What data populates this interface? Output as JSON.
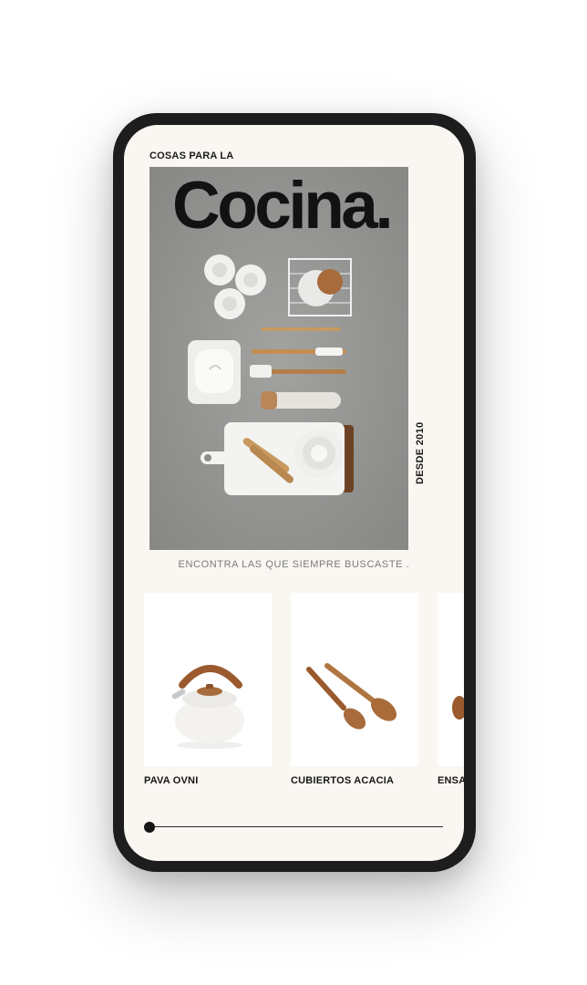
{
  "header": {
    "kicker": "COSAS PARA LA",
    "title": "Cocina.",
    "side_text": "DESDE 2010"
  },
  "tagline": "ENCONTRA LAS QUE SIEMPRE BUSCASTE .",
  "products": [
    {
      "name": "PAVA OVNI",
      "icon": "kettle-image"
    },
    {
      "name": "CUBIERTOS ACACIA",
      "icon": "wooden-spoons-image"
    },
    {
      "name": "ENSA",
      "icon": "salad-bowl-image"
    }
  ],
  "slider": {
    "progress": 0
  },
  "colors": {
    "background": "#faf7f2",
    "phone_frame": "#1d1d1d",
    "text": "#121212",
    "wood": "#a76b3c"
  }
}
